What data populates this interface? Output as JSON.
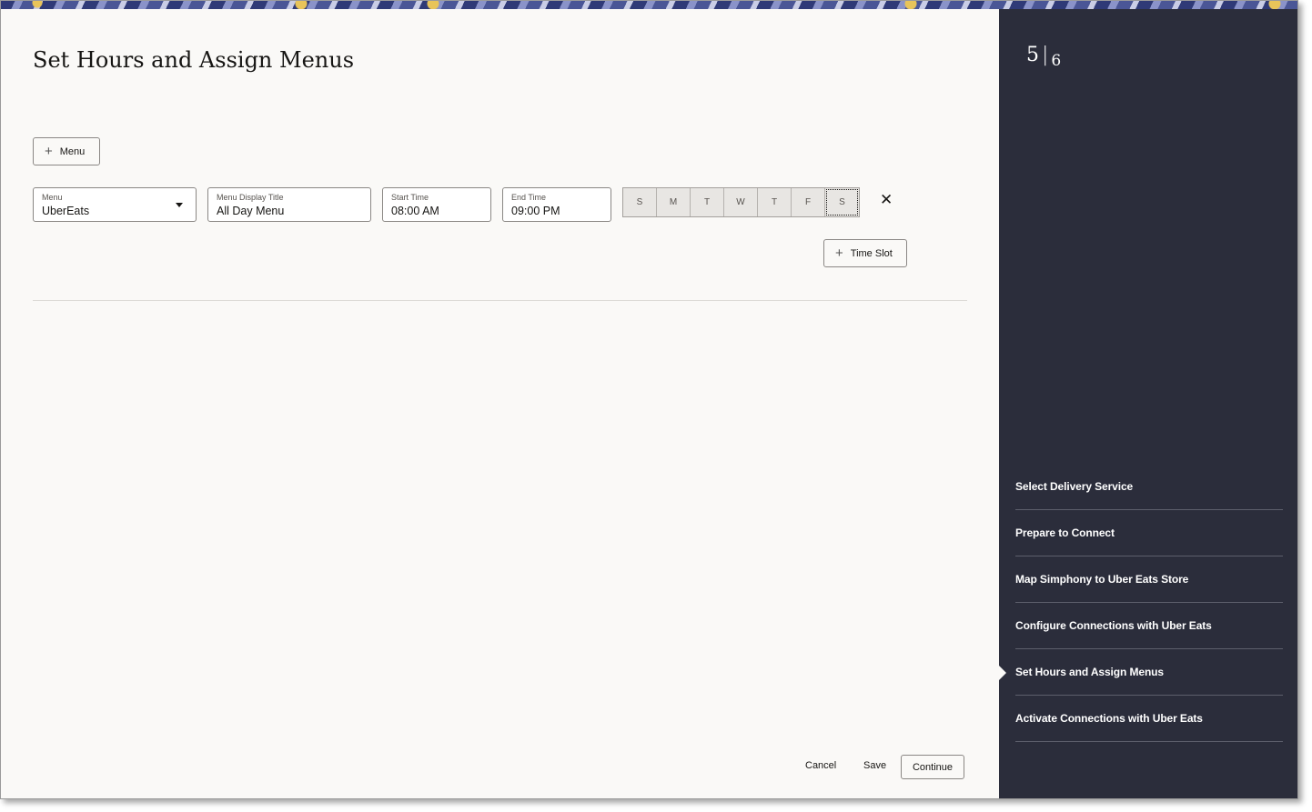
{
  "page": {
    "title": "Set Hours and Assign Menus"
  },
  "toolbar": {
    "add_menu_label": "Menu"
  },
  "time_slot_row": {
    "menu": {
      "label": "Menu",
      "value": "UberEats"
    },
    "display_title": {
      "label": "Menu Display Title",
      "value": "All Day Menu"
    },
    "start_time": {
      "label": "Start Time",
      "value": "08:00 AM"
    },
    "end_time": {
      "label": "End Time",
      "value": "09:00 PM"
    },
    "days": [
      "S",
      "M",
      "T",
      "W",
      "T",
      "F",
      "S"
    ],
    "remove_icon": "close-icon"
  },
  "add_time_slot_label": "Time Slot",
  "footer": {
    "cancel": "Cancel",
    "save": "Save",
    "continue": "Continue"
  },
  "sidebar": {
    "step_current": "5",
    "step_total": "6",
    "steps": [
      {
        "label": "Select Delivery Service"
      },
      {
        "label": "Prepare to Connect"
      },
      {
        "label": "Map Simphony to Uber Eats Store"
      },
      {
        "label": "Configure Connections with Uber Eats"
      },
      {
        "label": "Set Hours and Assign Menus",
        "active": true
      },
      {
        "label": "Activate Connections with Uber Eats"
      }
    ]
  },
  "colors": {
    "sidebar_bg": "#2b2d3b",
    "main_bg": "#faf9f7"
  }
}
